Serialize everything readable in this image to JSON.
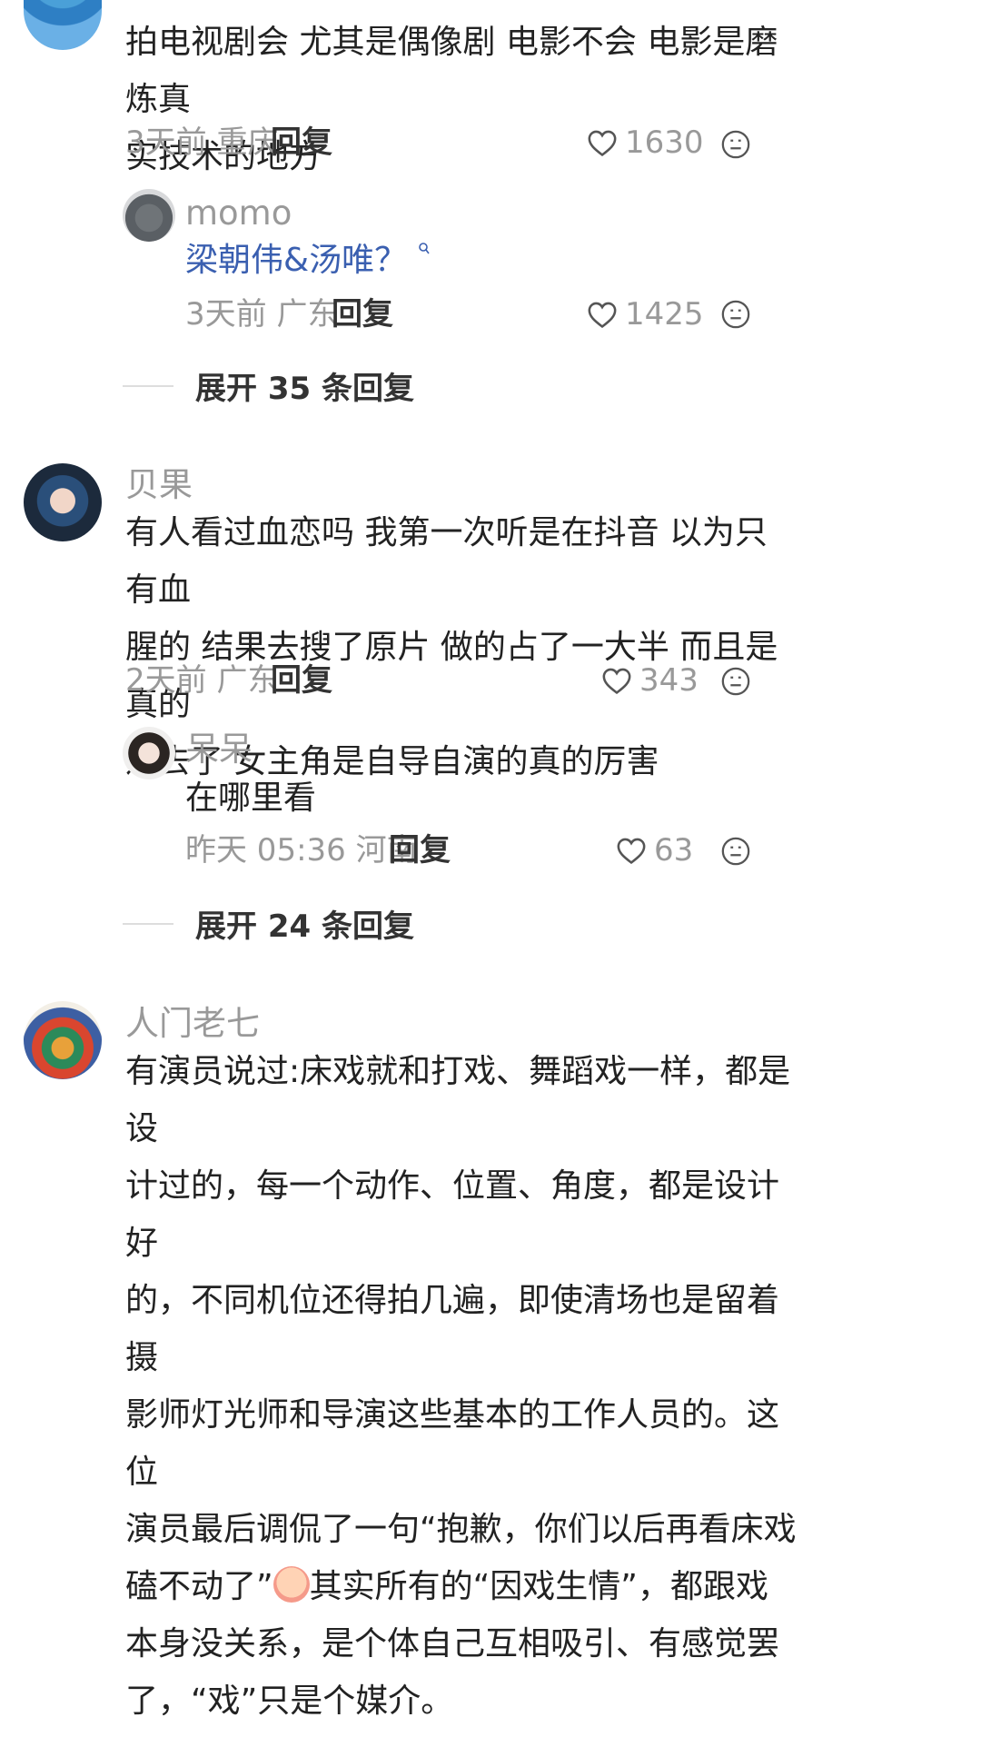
{
  "comments": [
    {
      "user": "",
      "text_lines": [
        "拍电视剧会 尤其是偶像剧 电影不会 电影是磨炼真",
        "实技术的地方"
      ],
      "meta": "3天前 重庆",
      "reply": "回复",
      "likes": "1630",
      "reply_preview": {
        "user": "momo",
        "text": "梁朝伟&汤唯？",
        "meta": "3天前 广东",
        "reply": "回复",
        "likes": "1425"
      },
      "expand": "展开 35 条回复"
    },
    {
      "user": "贝果",
      "text_lines": [
        "有人看过血恋吗 我第一次听是在抖音 以为只有血",
        "腥的 结果去搜了原片 做的占了一大半 而且是真的",
        "进去了 女主角是自导自演的真的厉害"
      ],
      "meta": "2天前 广东",
      "reply": "回复",
      "likes": "343",
      "reply_preview": {
        "user": "呆呆",
        "text": "在哪里看",
        "meta": "昨天 05:36 河南",
        "reply": "回复",
        "likes": "63"
      },
      "expand": "展开 24 条回复"
    },
    {
      "user": "人门老七",
      "text_lines": [
        "有演员说过:床戏就和打戏、舞蹈戏一样，都是设",
        "计过的，每一个动作、位置、角度，都是设计好",
        "的，不同机位还得拍几遍，即使清场也是留着摄",
        "影师灯光师和导演这些基本的工作人员的。这位",
        "演员最后调侃了一句“抱歉，你们以后再看床戏",
        "磕不动了”",
        "其实所有的“因戏生情”，都跟戏",
        "本身没关系，是个体自己互相吸引、有感觉罢",
        "了，“戏”只是个媒介。"
      ]
    }
  ],
  "colors": {
    "accent_link": "#3a5fb0",
    "meta": "#999999",
    "text": "#222222"
  }
}
